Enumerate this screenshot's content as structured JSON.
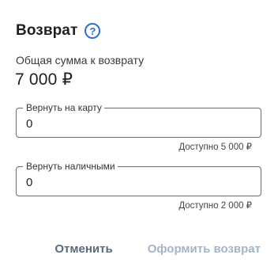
{
  "dialog": {
    "title": "Возврат",
    "help_icon_glyph": "?",
    "total_label": "Общая сумма к возврату",
    "total_value": "7 000 ₽"
  },
  "fields": {
    "card": {
      "label": "Вернуть на карту",
      "value": "0",
      "helper": "Доступно 5 000 ₽"
    },
    "cash": {
      "label": "Вернуть наличными",
      "value": "0",
      "helper": "Доступно 2 000 ₽"
    }
  },
  "actions": {
    "cancel_label": "Отменить",
    "submit_label": "Оформить возврат"
  },
  "colors": {
    "accent": "#2f6fd6",
    "cancel_text": "#5a6b7d",
    "submit_disabled_text": "#a3b4c6"
  },
  "icons": {
    "help": "question-circle-icon"
  }
}
